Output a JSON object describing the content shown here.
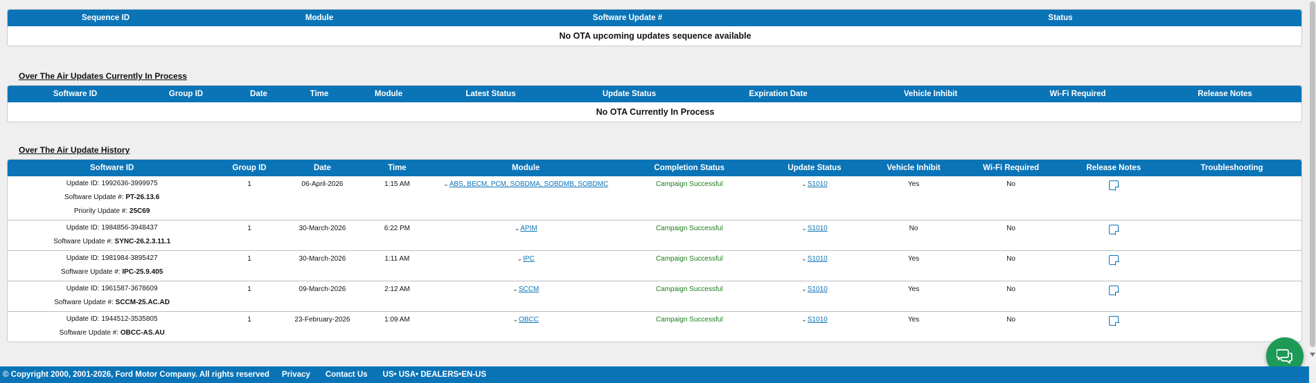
{
  "upcoming": {
    "headers": [
      "Sequence ID",
      "Module",
      "Software Update #",
      "Status"
    ],
    "empty_message": "No OTA upcoming updates sequence available"
  },
  "in_process": {
    "title": "Over The Air Updates Currently In Process",
    "headers": [
      "Software ID",
      "Group ID",
      "Date",
      "Time",
      "Module",
      "Latest Status",
      "Update Status",
      "Expiration Date",
      "Vehicle Inhibit",
      "Wi-Fi Required",
      "Release Notes"
    ],
    "empty_message": "No OTA Currently In Process"
  },
  "history": {
    "title": "Over The Air Update History",
    "headers": [
      "Software ID",
      "Group ID",
      "Date",
      "Time",
      "Module",
      "Completion Status",
      "Update Status",
      "Vehicle Inhibit",
      "Wi-Fi Required",
      "Release Notes",
      "Troubleshooting"
    ],
    "labels": {
      "update_id": "Update ID:",
      "software_update": "Software Update #:",
      "priority_update": "Priority Update #:"
    },
    "rows": [
      {
        "update_id": "1992636-3999975",
        "software_update": "PT-26.13.6",
        "priority_update": "25C69",
        "group_id": "1",
        "date": "06-April-2026",
        "time": "1:15 AM",
        "module": "ABS, BECM, PCM, SOBDMA, SOBDMB, SOBDMC",
        "completion_status": "Campaign Successful",
        "update_status": "S1010",
        "vehicle_inhibit": "Yes",
        "wifi_required": "No",
        "troubleshooting": ""
      },
      {
        "update_id": "1984856-3948437",
        "software_update": "SYNC-26.2.3.11.1",
        "group_id": "1",
        "date": "30-March-2026",
        "time": "6:22 PM",
        "module": "APIM",
        "completion_status": "Campaign Successful",
        "update_status": "S1010",
        "vehicle_inhibit": "No",
        "wifi_required": "No",
        "troubleshooting": ""
      },
      {
        "update_id": "1981984-3895427",
        "software_update": "IPC-25.9.405",
        "group_id": "1",
        "date": "30-March-2026",
        "time": "1:11 AM",
        "module": "IPC",
        "completion_status": "Campaign Successful",
        "update_status": "S1010",
        "vehicle_inhibit": "Yes",
        "wifi_required": "No",
        "troubleshooting": ""
      },
      {
        "update_id": "1961587-3678609",
        "software_update": "SCCM-25.AC.AD",
        "group_id": "1",
        "date": "09-March-2026",
        "time": "2:12 AM",
        "module": "SCCM",
        "completion_status": "Campaign Successful",
        "update_status": "S1010",
        "vehicle_inhibit": "Yes",
        "wifi_required": "No",
        "troubleshooting": ""
      },
      {
        "update_id": "1944512-3535805",
        "software_update": "OBCC-AS.AU",
        "group_id": "1",
        "date": "23-February-2026",
        "time": "1:09 AM",
        "module": "OBCC",
        "completion_status": "Campaign Successful",
        "update_status": "S1010",
        "vehicle_inhibit": "Yes",
        "wifi_required": "No",
        "troubleshooting": ""
      }
    ]
  },
  "footer": {
    "copyright": "© Copyright 2000, 2001-2026, Ford Motor Company. All rights reserved",
    "links": [
      "Privacy",
      "Contact Us",
      "US• USA• DEALERS•EN-US"
    ]
  },
  "colors": {
    "header_blue": "#0a74b7",
    "success_green": "#1a7d1a",
    "chat_green": "#1e9a57"
  },
  "icons": {
    "release_notes": "note-icon",
    "chat": "chat-icon",
    "expand": "chevron-down-icon"
  }
}
